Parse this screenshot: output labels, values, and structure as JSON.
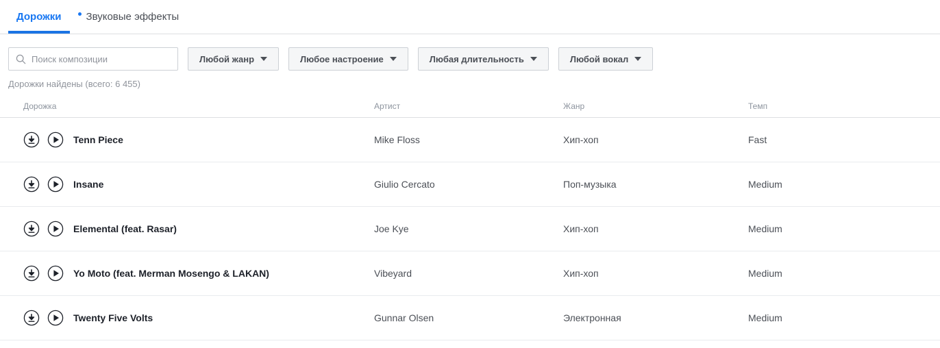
{
  "tabs": [
    {
      "label": "Дорожки",
      "active": true,
      "dot": false
    },
    {
      "label": "Звуковые эффекты",
      "active": false,
      "dot": true
    }
  ],
  "search": {
    "placeholder": "Поиск композиции",
    "value": "",
    "icon": "search-icon"
  },
  "filters": [
    {
      "label": "Любой жанр",
      "name": "genre"
    },
    {
      "label": "Любое настроение",
      "name": "mood"
    },
    {
      "label": "Любая длительность",
      "name": "duration"
    },
    {
      "label": "Любой вокал",
      "name": "vocal"
    }
  ],
  "results_count": "Дорожки найдены (всего: 6 455)",
  "table": {
    "columns": [
      "Дорожка",
      "Артист",
      "Жанр",
      "Темп"
    ],
    "rows": [
      {
        "track": "Tenn Piece",
        "artist": "Mike Floss",
        "genre": "Хип-хоп",
        "tempo": "Fast"
      },
      {
        "track": "Insane",
        "artist": "Giulio Cercato",
        "genre": "Поп-музыка",
        "tempo": "Medium"
      },
      {
        "track": "Elemental (feat. Rasar)",
        "artist": "Joe Kye",
        "genre": "Хип-хоп",
        "tempo": "Medium"
      },
      {
        "track": "Yo Moto (feat. Merman Mosengo & LAKAN)",
        "artist": "Vibeyard",
        "genre": "Хип-хоп",
        "tempo": "Medium"
      },
      {
        "track": "Twenty Five Volts",
        "artist": "Gunnar Olsen",
        "genre": "Электронная",
        "tempo": "Medium"
      }
    ]
  },
  "colors": {
    "accent": "#1877f2",
    "underline": "#1b74e4",
    "border": "#dddfe2",
    "row_border": "#e9ebee",
    "muted_text": "#90949c",
    "body_text": "#4b4f56",
    "title_text": "#1d2129",
    "button_bg": "#f5f6f7"
  }
}
